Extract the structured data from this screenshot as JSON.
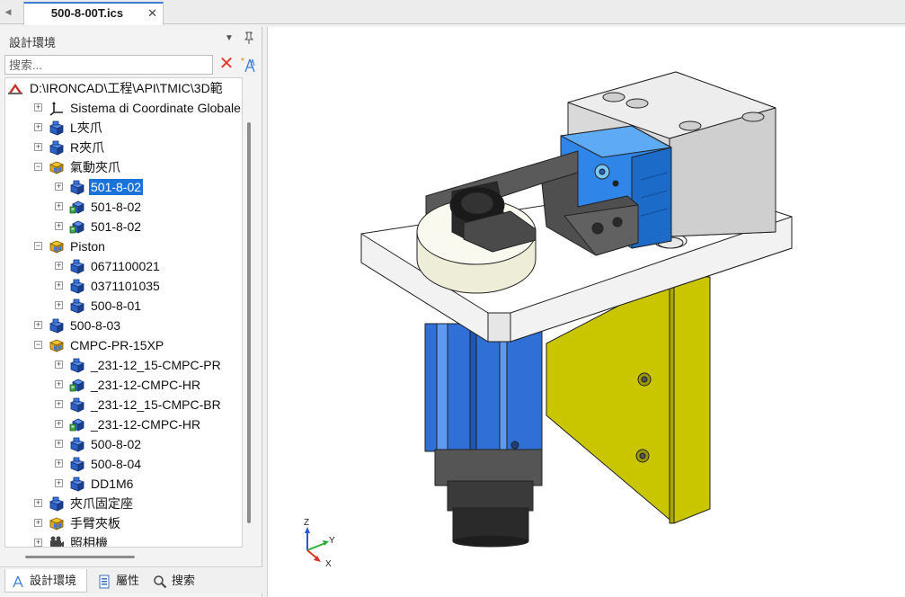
{
  "document_tab": {
    "title": "500-8-00T.ics"
  },
  "panel": {
    "title": "設計環境",
    "search_placeholder": "搜索...",
    "tree": [
      {
        "label": "D:\\IRONCAD\\工程\\API\\TMIC\\3D範",
        "icon": "scene-root-icon",
        "level": 0,
        "expander": "none"
      },
      {
        "label": "Sistema di Coordinate Globale",
        "icon": "coordinate-axes-icon",
        "level": 1,
        "expander": "plus"
      },
      {
        "label": "L夾爪",
        "icon": "part-icon",
        "level": 1,
        "expander": "plus"
      },
      {
        "label": "R夾爪",
        "icon": "part-icon",
        "level": 1,
        "expander": "plus"
      },
      {
        "label": "氣動夾爪",
        "icon": "assembly-icon",
        "level": 1,
        "expander": "minus"
      },
      {
        "label": "501-8-02",
        "icon": "part-icon",
        "level": 2,
        "expander": "plus",
        "selected": true
      },
      {
        "label": "501-8-02",
        "icon": "part-link-icon",
        "level": 2,
        "expander": "plus"
      },
      {
        "label": "501-8-02",
        "icon": "part-link-icon",
        "level": 2,
        "expander": "plus"
      },
      {
        "label": "Piston",
        "icon": "assembly-icon",
        "level": 1,
        "expander": "minus"
      },
      {
        "label": "0671100021",
        "icon": "part-icon",
        "level": 2,
        "expander": "plus"
      },
      {
        "label": "0371101035",
        "icon": "part-icon",
        "level": 2,
        "expander": "plus"
      },
      {
        "label": "500-8-01",
        "icon": "part-icon",
        "level": 2,
        "expander": "plus"
      },
      {
        "label": "500-8-03",
        "icon": "part-icon",
        "level": 1,
        "expander": "plus"
      },
      {
        "label": "CMPC-PR-15XP",
        "icon": "assembly-icon",
        "level": 1,
        "expander": "minus"
      },
      {
        "label": "_231-12_15-CMPC-PR",
        "icon": "part-icon",
        "level": 2,
        "expander": "plus"
      },
      {
        "label": "_231-12-CMPC-HR",
        "icon": "part-link-icon",
        "level": 2,
        "expander": "plus"
      },
      {
        "label": "_231-12_15-CMPC-BR",
        "icon": "part-icon",
        "level": 2,
        "expander": "plus"
      },
      {
        "label": "_231-12-CMPC-HR",
        "icon": "part-link-icon",
        "level": 2,
        "expander": "plus"
      },
      {
        "label": "500-8-02",
        "icon": "part-icon",
        "level": 2,
        "expander": "plus"
      },
      {
        "label": "500-8-04",
        "icon": "part-icon",
        "level": 2,
        "expander": "plus"
      },
      {
        "label": "DD1M6",
        "icon": "part-icon",
        "level": 2,
        "expander": "plus"
      },
      {
        "label": "夾爪固定座",
        "icon": "part-icon",
        "level": 1,
        "expander": "plus"
      },
      {
        "label": "手臂夾板",
        "icon": "assembly-icon",
        "level": 1,
        "expander": "plus"
      },
      {
        "label": "照相機",
        "icon": "camera-icon",
        "level": 1,
        "expander": "plus"
      }
    ],
    "bottom_tabs": [
      {
        "label": "設計環境",
        "icon": "scene-tree-icon",
        "active": true
      },
      {
        "label": "屬性",
        "icon": "properties-icon",
        "active": false
      },
      {
        "label": "搜索",
        "icon": "search-icon",
        "active": false
      }
    ]
  },
  "viewport": {
    "axes": {
      "z": "Z",
      "y": "Y",
      "x": "X"
    }
  },
  "colors": {
    "selection": "#1a73d9",
    "part_blue": "#2f6fd6",
    "plate_yellow": "#c9c600",
    "block_gray": "#d9d9d9"
  }
}
